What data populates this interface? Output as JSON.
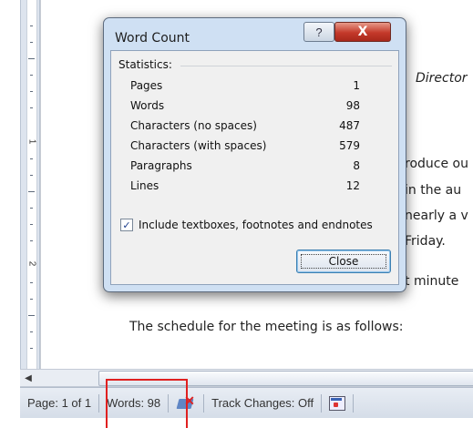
{
  "document": {
    "lines": [
      "Director",
      "roduce ou",
      "in the au",
      "nearly a v",
      "Friday.",
      "t minute",
      "The schedule for the meeting is as follows:"
    ]
  },
  "ruler": {
    "marks": [
      "1",
      "2"
    ]
  },
  "dialog": {
    "title": "Word Count",
    "help_label": "?",
    "close_x_label": "X",
    "statistics_label": "Statistics:",
    "stats": [
      {
        "label": "Pages",
        "value": "1"
      },
      {
        "label": "Words",
        "value": "98"
      },
      {
        "label": "Characters (no spaces)",
        "value": "487"
      },
      {
        "label": "Characters (with spaces)",
        "value": "579"
      },
      {
        "label": "Paragraphs",
        "value": "8"
      },
      {
        "label": "Lines",
        "value": "12"
      }
    ],
    "checkbox_label": "Include textboxes, footnotes and endnotes",
    "checkbox_checked": true,
    "checkbox_mark": "✓",
    "close_button_label": "Close"
  },
  "scrollbar": {
    "left_arrow": "◀"
  },
  "statusbar": {
    "page": "Page: 1 of 1",
    "words": "Words: 98",
    "track_changes": "Track Changes: Off",
    "proofing_icon": "proofing-errors-icon",
    "macro_icon": "macro-record-icon"
  },
  "colors": {
    "highlight": "#e02020",
    "close_x": "#c4392a"
  }
}
